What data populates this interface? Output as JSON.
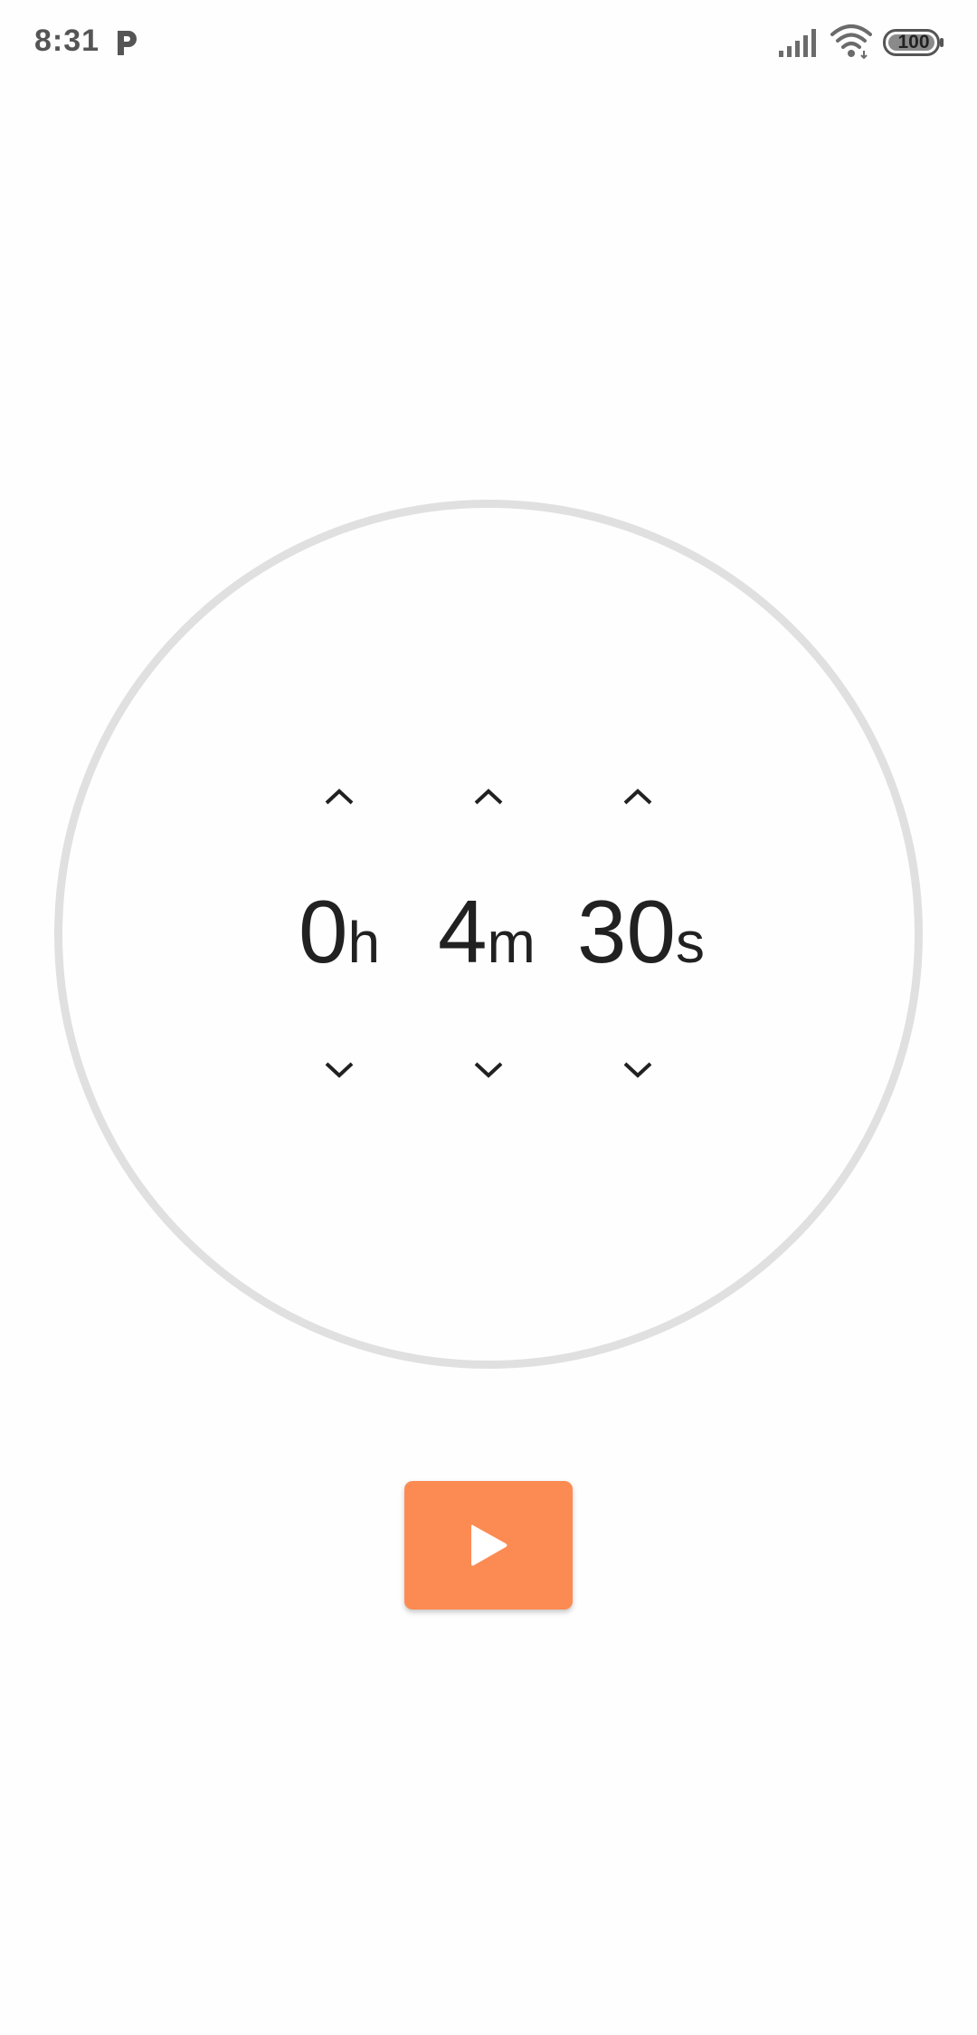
{
  "status_bar": {
    "time": "8:31",
    "notification_icon": "p-app-icon",
    "signal_icon": "cell-signal-icon",
    "wifi_icon": "wifi-icon",
    "battery_level": "100"
  },
  "timer": {
    "hours": {
      "value": "0",
      "unit": "h"
    },
    "minutes": {
      "value": "4",
      "unit": "m"
    },
    "seconds": {
      "value": "30",
      "unit": "s"
    },
    "increment_icon": "chevron-up-icon",
    "decrement_icon": "chevron-down-icon"
  },
  "controls": {
    "start_icon": "play-icon"
  },
  "colors": {
    "accent": "#fc8b53",
    "ring": "#e0e0e0",
    "text": "#212121",
    "status_text": "#555555"
  }
}
